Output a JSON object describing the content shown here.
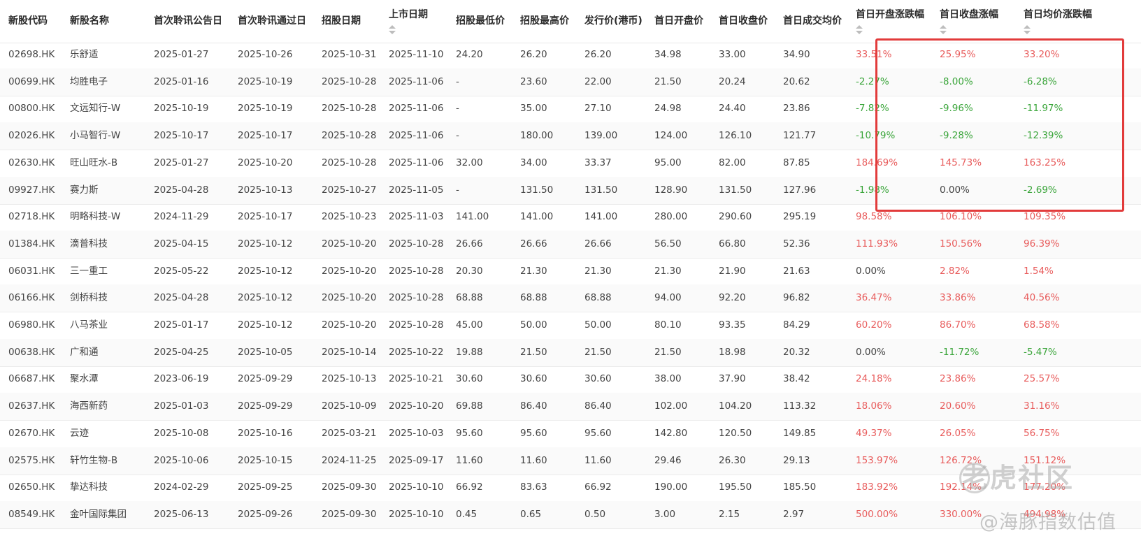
{
  "columns": [
    {
      "key": "code",
      "label": "新股代码",
      "sortable": false
    },
    {
      "key": "name",
      "label": "新股名称",
      "sortable": false
    },
    {
      "key": "first_hearing_announce",
      "label": "首次聆讯公告日",
      "sortable": false
    },
    {
      "key": "first_hearing_pass",
      "label": "首次聆讯通过日",
      "sortable": false
    },
    {
      "key": "subscription_date",
      "label": "招股日期",
      "sortable": false
    },
    {
      "key": "listing_date",
      "label": "上市日期",
      "sortable": true
    },
    {
      "key": "offer_low",
      "label": "招股最低价",
      "sortable": false
    },
    {
      "key": "offer_high",
      "label": "招股最高价",
      "sortable": false
    },
    {
      "key": "issue_price",
      "label": "发行价(港币)",
      "sortable": false
    },
    {
      "key": "day1_open",
      "label": "首日开盘价",
      "sortable": false
    },
    {
      "key": "day1_close",
      "label": "首日收盘价",
      "sortable": false
    },
    {
      "key": "day1_avg",
      "label": "首日成交均价",
      "sortable": false
    },
    {
      "key": "day1_open_chg",
      "label": "首日开盘涨跌幅",
      "sortable": true
    },
    {
      "key": "day1_close_chg",
      "label": "首日收盘涨幅",
      "sortable": true
    },
    {
      "key": "day1_avg_chg",
      "label": "首日均价涨跌幅",
      "sortable": true
    }
  ],
  "rows": [
    [
      "02698.HK",
      "乐舒适",
      "2025-01-27",
      "2025-10-26",
      "2025-10-31",
      "2025-11-10",
      "24.20",
      "26.20",
      "26.20",
      "34.98",
      "33.00",
      "34.90",
      "33.51%",
      "25.95%",
      "33.20%"
    ],
    [
      "00699.HK",
      "均胜电子",
      "2025-01-16",
      "2025-10-19",
      "2025-10-28",
      "2025-11-06",
      "-",
      "23.60",
      "22.00",
      "21.50",
      "20.24",
      "20.62",
      "-2.27%",
      "-8.00%",
      "-6.28%"
    ],
    [
      "00800.HK",
      "文远知行-W",
      "2025-10-19",
      "2025-10-19",
      "2025-10-28",
      "2025-11-06",
      "-",
      "35.00",
      "27.10",
      "24.98",
      "24.40",
      "23.86",
      "-7.82%",
      "-9.96%",
      "-11.97%"
    ],
    [
      "02026.HK",
      "小马智行-W",
      "2025-10-17",
      "2025-10-17",
      "2025-10-28",
      "2025-11-06",
      "-",
      "180.00",
      "139.00",
      "124.00",
      "126.10",
      "121.77",
      "-10.79%",
      "-9.28%",
      "-12.39%"
    ],
    [
      "02630.HK",
      "旺山旺水-B",
      "2025-01-27",
      "2025-10-20",
      "2025-10-28",
      "2025-11-06",
      "32.00",
      "34.00",
      "33.37",
      "95.00",
      "82.00",
      "87.85",
      "184.69%",
      "145.73%",
      "163.25%"
    ],
    [
      "09927.HK",
      "赛力斯",
      "2025-04-28",
      "2025-10-13",
      "2025-10-27",
      "2025-11-05",
      "-",
      "131.50",
      "131.50",
      "128.90",
      "131.50",
      "127.96",
      "-1.98%",
      "0.00%",
      "-2.69%"
    ],
    [
      "02718.HK",
      "明略科技-W",
      "2024-11-29",
      "2025-10-17",
      "2025-10-23",
      "2025-11-03",
      "141.00",
      "141.00",
      "141.00",
      "280.00",
      "290.60",
      "295.19",
      "98.58%",
      "106.10%",
      "109.35%"
    ],
    [
      "01384.HK",
      "滴普科技",
      "2025-04-15",
      "2025-10-12",
      "2025-10-20",
      "2025-10-28",
      "26.66",
      "26.66",
      "26.66",
      "56.50",
      "66.80",
      "52.36",
      "111.93%",
      "150.56%",
      "96.39%"
    ],
    [
      "06031.HK",
      "三一重工",
      "2025-05-22",
      "2025-10-12",
      "2025-10-20",
      "2025-10-28",
      "20.30",
      "21.30",
      "21.30",
      "21.30",
      "21.90",
      "21.63",
      "0.00%",
      "2.82%",
      "1.54%"
    ],
    [
      "06166.HK",
      "剑桥科技",
      "2025-04-28",
      "2025-10-12",
      "2025-10-20",
      "2025-10-28",
      "68.88",
      "68.88",
      "68.88",
      "94.00",
      "92.20",
      "96.82",
      "36.47%",
      "33.86%",
      "40.56%"
    ],
    [
      "06980.HK",
      "八马茶业",
      "2025-01-17",
      "2025-10-12",
      "2025-10-20",
      "2025-10-28",
      "45.00",
      "50.00",
      "50.00",
      "80.10",
      "93.35",
      "84.29",
      "60.20%",
      "86.70%",
      "68.58%"
    ],
    [
      "00638.HK",
      "广和通",
      "2025-04-25",
      "2025-10-05",
      "2025-10-14",
      "2025-10-22",
      "19.88",
      "21.50",
      "21.50",
      "21.50",
      "18.98",
      "20.32",
      "0.00%",
      "-11.72%",
      "-5.47%"
    ],
    [
      "06687.HK",
      "聚水潭",
      "2023-06-19",
      "2025-09-29",
      "2025-10-13",
      "2025-10-21",
      "30.60",
      "30.60",
      "30.60",
      "38.00",
      "37.90",
      "38.42",
      "24.18%",
      "23.86%",
      "25.57%"
    ],
    [
      "02637.HK",
      "海西新药",
      "2025-01-03",
      "2025-09-29",
      "2025-10-09",
      "2025-10-20",
      "69.88",
      "86.40",
      "86.40",
      "102.00",
      "104.20",
      "113.32",
      "18.06%",
      "20.60%",
      "31.16%"
    ],
    [
      "02670.HK",
      "云迹",
      "2025-10-08",
      "2025-10-16",
      "2025-03-21",
      "2025-10-03",
      "95.60",
      "95.60",
      "95.60",
      "142.80",
      "120.50",
      "149.85",
      "49.37%",
      "26.05%",
      "56.75%"
    ],
    [
      "02575.HK",
      "轩竹生物-B",
      "2025-10-06",
      "2025-10-15",
      "2024-11-25",
      "2025-09-17",
      "11.60",
      "11.60",
      "11.60",
      "29.46",
      "26.30",
      "29.13",
      "153.97%",
      "126.72%",
      "151.12%"
    ],
    [
      "02650.HK",
      "挚达科技",
      "2024-02-29",
      "2025-09-25",
      "2025-09-30",
      "2025-10-10",
      "66.92",
      "83.63",
      "66.92",
      "190.00",
      "195.50",
      "185.50",
      "183.92%",
      "192.14%",
      "177.20%"
    ],
    [
      "08549.HK",
      "金叶国际集团",
      "2025-06-13",
      "2025-09-26",
      "2025-09-30",
      "2025-10-10",
      "0.45",
      "0.65",
      "0.50",
      "3.00",
      "2.15",
      "2.97",
      "500.00%",
      "330.00%",
      "494.98%"
    ]
  ],
  "colors": {
    "positive": "#e85c5c",
    "negative": "#3aa53a",
    "highlight_border": "#e23b3b"
  },
  "icons": {
    "sort": "sort-up-down-icon",
    "watermark_logo": "tiger-logo-icon"
  },
  "watermark": {
    "community": "老虎社区",
    "author": "@海豚指数估值"
  }
}
